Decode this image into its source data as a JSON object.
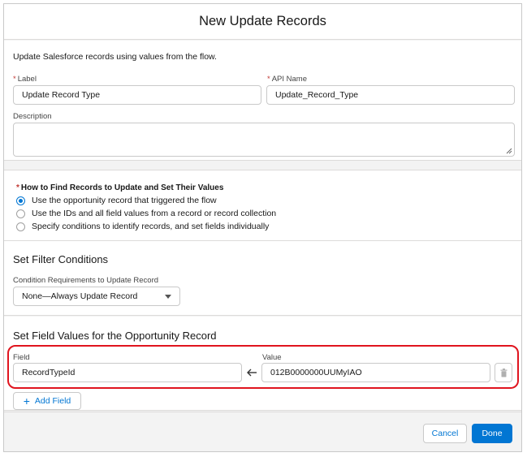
{
  "modal": {
    "title": "New Update Records"
  },
  "general": {
    "intro": "Update Salesforce records using values from the flow.",
    "label_field": {
      "label": "Label",
      "value": "Update Record Type"
    },
    "api_field": {
      "label": "API Name",
      "value": "Update_Record_Type"
    },
    "description": {
      "label": "Description",
      "value": ""
    }
  },
  "find": {
    "label": "How to Find Records to Update and Set Their Values",
    "options": [
      "Use the opportunity record that triggered the flow",
      "Use the IDs and all field values from a record or record collection",
      "Specify conditions to identify records, and set fields individually"
    ],
    "selected_index": 0
  },
  "filter": {
    "title": "Set Filter Conditions",
    "requirement_label": "Condition Requirements to Update Record",
    "requirement_value": "None—Always Update Record"
  },
  "field_values": {
    "title": "Set Field Values for the Opportunity Record",
    "field_header": "Field",
    "value_header": "Value",
    "rows": [
      {
        "field": "RecordTypeId",
        "value": "012B0000000UUMyIAO"
      }
    ],
    "add_label": "Add Field"
  },
  "footer": {
    "cancel_label": "Cancel",
    "done_label": "Done"
  },
  "colors": {
    "brand": "#0176d3",
    "required": "#c23934",
    "highlight": "#e0141e"
  },
  "icons": [
    "arrow-left-icon",
    "trash-icon",
    "plus-icon",
    "chevron-down-icon",
    "resize-grip-icon"
  ]
}
